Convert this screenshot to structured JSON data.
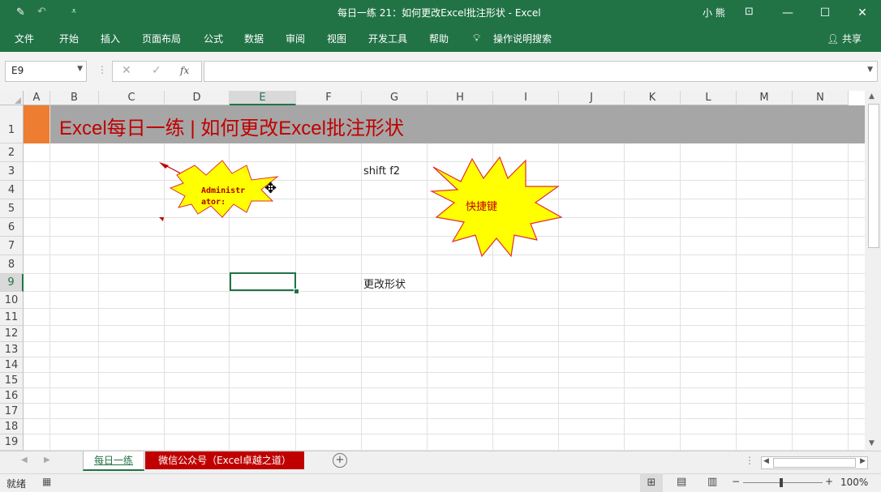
{
  "titlebar": {
    "title": "每日一练 21：如何更改Excel批注形状  -  Excel",
    "user": "小 熊",
    "colors": {
      "accent": "#217346"
    }
  },
  "ribbon": {
    "tabs": [
      "文件",
      "开始",
      "插入",
      "页面布局",
      "公式",
      "数据",
      "审阅",
      "视图",
      "开发工具",
      "帮助"
    ],
    "tell_me": "操作说明搜索",
    "share": "共享"
  },
  "formula_bar": {
    "name_box": "E9",
    "fx": "fx",
    "formula": ""
  },
  "grid": {
    "columns": [
      "A",
      "B",
      "C",
      "D",
      "E",
      "F",
      "G",
      "H",
      "I",
      "J",
      "K",
      "L",
      "M",
      "N"
    ],
    "rows": [
      "1",
      "2",
      "3",
      "4",
      "5",
      "6",
      "7",
      "8",
      "9",
      "10",
      "11",
      "12",
      "13",
      "14",
      "15",
      "16",
      "17",
      "18",
      "19"
    ],
    "selected_col": "E",
    "selected_row": "9",
    "banner_title": "Excel每日一练 | 如何更改Excel批注形状",
    "cells": {
      "G3": "shift f2",
      "G9": "更改形状"
    },
    "comment_text": "Administrator:",
    "comment_line1": "Administr",
    "comment_line2": "ator:",
    "starburst_label": "快捷键",
    "colors": {
      "banner_bg": "#a6a6a6",
      "banner_text": "#c00000",
      "a1_fill": "#ed7d31",
      "shape_fill": "#ffff00",
      "shape_border": "#e03030"
    }
  },
  "sheet_tabs": {
    "tabs": [
      "每日一练",
      "微信公众号（Excel卓越之道）"
    ],
    "active": "每日一练"
  },
  "status": {
    "ready": "就绪",
    "zoom": "100%"
  }
}
